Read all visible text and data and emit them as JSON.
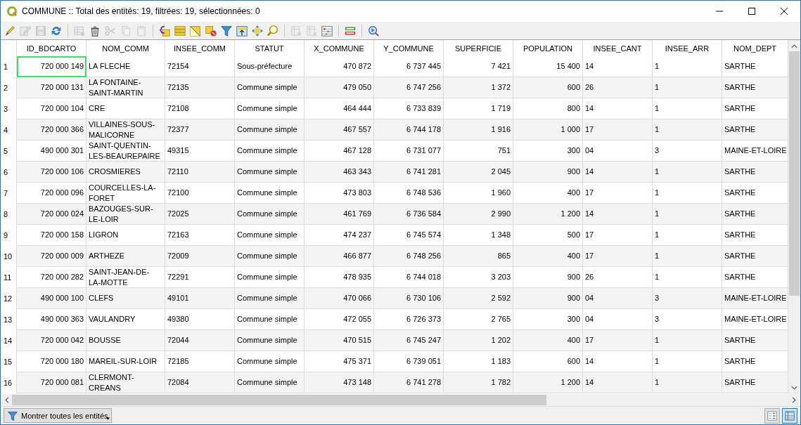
{
  "window": {
    "title": "COMMUNE :: Total des entités: 19, filtrées: 19, sélectionnées: 0"
  },
  "toolbar": [
    {
      "kind": "pencil",
      "disabled": false
    },
    {
      "kind": "multi-edit",
      "disabled": true
    },
    {
      "kind": "save",
      "disabled": true
    },
    {
      "kind": "refresh",
      "disabled": false
    },
    {
      "kind": "separator"
    },
    {
      "kind": "add-row",
      "disabled": true
    },
    {
      "kind": "trash",
      "disabled": false
    },
    {
      "kind": "cut",
      "disabled": true
    },
    {
      "kind": "copy",
      "disabled": true
    },
    {
      "kind": "paste",
      "disabled": true
    },
    {
      "kind": "separator"
    },
    {
      "kind": "expression",
      "disabled": false
    },
    {
      "kind": "select-all",
      "disabled": false
    },
    {
      "kind": "invert",
      "disabled": false
    },
    {
      "kind": "deselect",
      "disabled": false
    },
    {
      "kind": "filter",
      "disabled": false
    },
    {
      "kind": "move-top",
      "disabled": false
    },
    {
      "kind": "pan",
      "disabled": false
    },
    {
      "kind": "zoom",
      "disabled": false
    },
    {
      "kind": "separator"
    },
    {
      "kind": "new-field",
      "disabled": true
    },
    {
      "kind": "delete-field",
      "disabled": true
    },
    {
      "kind": "calculator",
      "disabled": false
    },
    {
      "kind": "separator"
    },
    {
      "kind": "format",
      "disabled": false
    },
    {
      "kind": "separator"
    },
    {
      "kind": "actions",
      "disabled": false
    }
  ],
  "table": {
    "columns": [
      "ID_BDCARTO",
      "NOM_COMM",
      "INSEE_COMM",
      "STATUT",
      "X_COMMUNE",
      "Y_COMMUNE",
      "SUPERFICIE",
      "POPULATION",
      "INSEE_CANT",
      "INSEE_ARR",
      "NOM_DEPT"
    ],
    "rows": [
      {
        "number": "1",
        "focused": true,
        "cells": [
          "720 000 149",
          "LA FLECHE",
          "72154",
          "Sous-préfecture",
          "470 872",
          "6 737 445",
          "7 421",
          "15 400",
          "14",
          "1",
          "SARTHE"
        ]
      },
      {
        "number": "2",
        "focused": false,
        "cells": [
          "720 000 131",
          "LA FONTAINE-\nSAINT-MARTIN",
          "72135",
          "Commune simple",
          "479 050",
          "6 747 256",
          "1 372",
          "600",
          "26",
          "1",
          "SARTHE"
        ]
      },
      {
        "number": "3",
        "focused": false,
        "cells": [
          "720 000 104",
          "CRE",
          "72108",
          "Commune simple",
          "464 444",
          "6 733 839",
          "1 719",
          "800",
          "14",
          "1",
          "SARTHE"
        ]
      },
      {
        "number": "4",
        "focused": false,
        "cells": [
          "720 000 366",
          "VILLAINES-SOUS-\nMALICORNE",
          "72377",
          "Commune simple",
          "467 557",
          "6 744 178",
          "1 916",
          "1 000",
          "17",
          "1",
          "SARTHE"
        ]
      },
      {
        "number": "5",
        "focused": false,
        "cells": [
          "490 000 301",
          "SAINT-QUENTIN-\nLES-BEAUREPAIRE",
          "49315",
          "Commune simple",
          "467 128",
          "6 731 077",
          "751",
          "300",
          "04",
          "3",
          "MAINE-ET-LOIRE"
        ]
      },
      {
        "number": "6",
        "focused": false,
        "cells": [
          "720 000 106",
          "CROSMIERES",
          "72110",
          "Commune simple",
          "463 343",
          "6 741 281",
          "2 045",
          "900",
          "14",
          "1",
          "SARTHE"
        ]
      },
      {
        "number": "7",
        "focused": false,
        "cells": [
          "720 000 096",
          "COURCELLES-LA-\nFORET",
          "72100",
          "Commune simple",
          "473 803",
          "6 748 536",
          "1 960",
          "400",
          "17",
          "1",
          "SARTHE"
        ]
      },
      {
        "number": "8",
        "focused": false,
        "cells": [
          "720 000 024",
          "BAZOUGES-SUR-\nLE-LOIR",
          "72025",
          "Commune simple",
          "461 769",
          "6 736 584",
          "2 990",
          "1 200",
          "14",
          "1",
          "SARTHE"
        ]
      },
      {
        "number": "9",
        "focused": false,
        "cells": [
          "720 000 158",
          "LIGRON",
          "72163",
          "Commune simple",
          "474 237",
          "6 745 574",
          "1 348",
          "500",
          "17",
          "1",
          "SARTHE"
        ]
      },
      {
        "number": "10",
        "focused": false,
        "cells": [
          "720 000 009",
          "ARTHEZE",
          "72009",
          "Commune simple",
          "466 877",
          "6 748 256",
          "865",
          "400",
          "17",
          "1",
          "SARTHE"
        ]
      },
      {
        "number": "11",
        "focused": false,
        "cells": [
          "720 000 282",
          "SAINT-JEAN-DE-\nLA-MOTTE",
          "72291",
          "Commune simple",
          "478 935",
          "6 744 018",
          "3 203",
          "900",
          "26",
          "1",
          "SARTHE"
        ]
      },
      {
        "number": "12",
        "focused": false,
        "cells": [
          "490 000 100",
          "CLEFS",
          "49101",
          "Commune simple",
          "470 066",
          "6 730 106",
          "2 592",
          "900",
          "04",
          "3",
          "MAINE-ET-LOIRE"
        ]
      },
      {
        "number": "13",
        "focused": false,
        "cells": [
          "490 000 363",
          "VAULANDRY",
          "49380",
          "Commune simple",
          "472 055",
          "6 726 373",
          "2 765",
          "300",
          "04",
          "3",
          "MAINE-ET-LOIRE"
        ]
      },
      {
        "number": "14",
        "focused": false,
        "cells": [
          "720 000 042",
          "BOUSSE",
          "72044",
          "Commune simple",
          "470 515",
          "6 745 247",
          "1 202",
          "400",
          "17",
          "1",
          "SARTHE"
        ]
      },
      {
        "number": "15",
        "focused": false,
        "cells": [
          "720 000 180",
          "MAREIL-SUR-LOIR",
          "72185",
          "Commune simple",
          "475 371",
          "6 739 051",
          "1 183",
          "600",
          "14",
          "1",
          "SARTHE"
        ]
      },
      {
        "number": "16",
        "focused": false,
        "cells": [
          "720 000 081",
          "CLERMONT-\nCREANS",
          "72084",
          "Commune simple",
          "473 148",
          "6 741 278",
          "1 782",
          "1 200",
          "14",
          "1",
          "SARTHE"
        ]
      }
    ]
  },
  "bottom_bar": {
    "filter_button": "Montrer toutes les entités",
    "view_buttons": [
      {
        "kind": "form",
        "selected": false
      },
      {
        "kind": "table",
        "selected": true
      }
    ]
  }
}
